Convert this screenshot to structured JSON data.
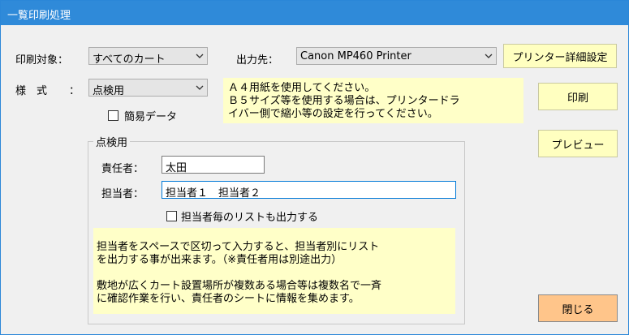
{
  "window": {
    "title": "一覧印刷処理"
  },
  "print_target": {
    "label": "印刷対象：",
    "value": "すべてのカート"
  },
  "output": {
    "label": "出力先：",
    "value": "Canon MP460 Printer"
  },
  "printer_settings_button": "プリンター詳細設定",
  "style": {
    "label": "様　式",
    "colon": "：",
    "value": "点検用"
  },
  "notice": {
    "text": "Ａ４用紙を使用してください。\nＢ５サイズ等を使用する場合は、プリンタードラ\nイバー側で縮小等の設定を行ってください。"
  },
  "simple_data": {
    "label": "簡易データ",
    "checked": false
  },
  "print_button": "印刷",
  "preview_button": "プレビュー",
  "group": {
    "title": "点検用",
    "responsible": {
      "label": "責任者：",
      "value": "太田"
    },
    "assignee": {
      "label": "担当者：",
      "value": "担当者１　担当者２"
    },
    "per_assignee": {
      "label": "担当者毎のリストも出力する",
      "checked": false
    },
    "info": {
      "text": "担当者をスペースで区切って入力すると、担当者別にリスト\nを出力する事が出来ます。（※責任者用は別途出力）\n\n敷地が広くカート設置場所が複数ある場合等は複数名で一斉\nに確認作業を行い、責任者のシートに情報を集めます。"
    }
  },
  "close_button": "閉じる",
  "colors": {
    "title_bar": "#2f8ad9",
    "button_yellow": "#ffffc0",
    "note_bg": "#ffffc8",
    "close_orange": "#ffc58a"
  }
}
